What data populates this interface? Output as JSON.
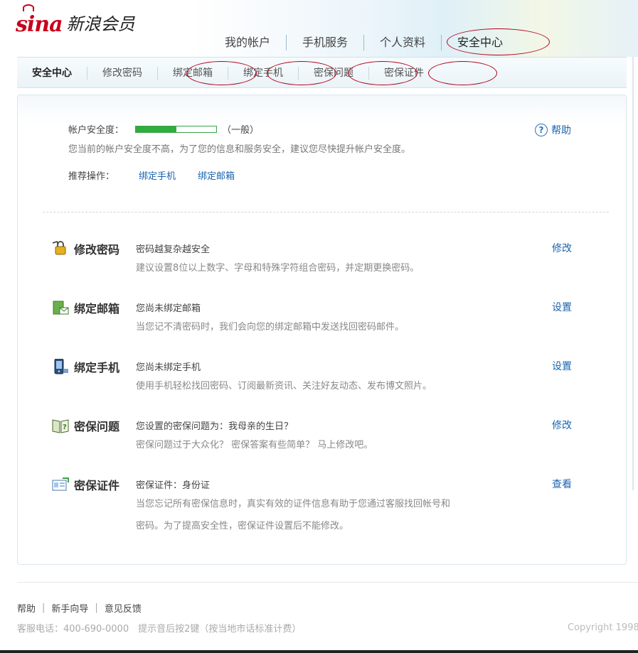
{
  "brand": {
    "logo_text": "sina",
    "title": "新浪会员"
  },
  "top_nav": [
    "我的帐户",
    "手机服务",
    "个人资料",
    "安全中心"
  ],
  "sub_nav": [
    "安全中心",
    "修改密码",
    "绑定邮箱",
    "绑定手机",
    "密保问题",
    "密保证件"
  ],
  "security": {
    "label": "帐户安全度：",
    "level_fraction": 0.5,
    "level_text": "（一般）",
    "description": "您当前的帐户安全度不高，为了您的信息和服务安全，建议您尽快提升帐户安全度。",
    "recommend_label": "推荐操作：",
    "recommend_links": [
      "绑定手机",
      "绑定邮箱"
    ]
  },
  "help": {
    "label": "帮助",
    "icon": "question-icon"
  },
  "items": [
    {
      "icon": "password-key-icon",
      "title": "修改密码",
      "status": "密码越复杂越安全",
      "desc": [
        "建议设置8位以上数字、字母和特殊字符组合密码，并定期更换密码。"
      ],
      "action": "修改"
    },
    {
      "icon": "email-icon",
      "title": "绑定邮箱",
      "status": "您尚未绑定邮箱",
      "desc": [
        "当您记不清密码时，我们会向您的绑定邮箱中发送找回密码邮件。"
      ],
      "action": "设置"
    },
    {
      "icon": "mobile-phone-icon",
      "title": "绑定手机",
      "status": "您尚未绑定手机",
      "desc": [
        "使用手机轻松找回密码、订阅最新资讯、关注好友动态、发布博文照片。"
      ],
      "action": "设置"
    },
    {
      "icon": "question-book-icon",
      "title": "密保问题",
      "status": "您设置的密保问题为：我母亲的生日？",
      "desc": [
        "密保问题过于大众化？ 密保答案有些简单？ 马上修改吧。"
      ],
      "action": "修改"
    },
    {
      "icon": "id-card-icon",
      "title": "密保证件",
      "status": "密保证件：身份证",
      "desc": [
        "当您忘记所有密保信息时，真实有效的证件信息有助于您通过客服找回帐号和",
        "密码。为了提高安全性，密保证件设置后不能修改。"
      ],
      "action": "查看"
    }
  ],
  "footer": {
    "links": [
      "帮助",
      "新手向导",
      "意见反馈"
    ],
    "info": "客服电话：400-690-0000　提示音后按2键（按当地市话标准计费）",
    "copyright": "Copyright 1998"
  },
  "colors": {
    "link": "#1a64b0",
    "meter_fill": "#2fae3d",
    "annotation_oval": "#b3001b",
    "brand_red": "#c8001a"
  }
}
